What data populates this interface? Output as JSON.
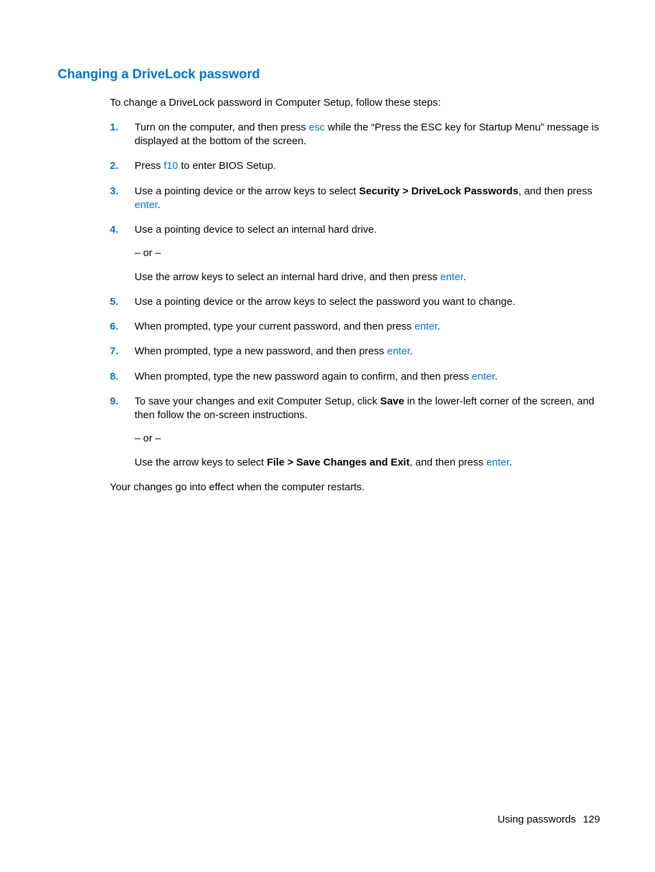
{
  "heading": "Changing a DriveLock password",
  "intro": "To change a DriveLock password in Computer Setup, follow these steps:",
  "steps": [
    {
      "num": "1.",
      "paras": [
        [
          {
            "t": "Turn on the computer, and then press "
          },
          {
            "t": "esc",
            "key": true
          },
          {
            "t": " while the “Press the ESC key for Startup Menu” message is displayed at the bottom of the screen."
          }
        ]
      ]
    },
    {
      "num": "2.",
      "paras": [
        [
          {
            "t": "Press "
          },
          {
            "t": "f10",
            "key": true
          },
          {
            "t": " to enter BIOS Setup."
          }
        ]
      ]
    },
    {
      "num": "3.",
      "paras": [
        [
          {
            "t": "Use a pointing device or the arrow keys to select "
          },
          {
            "t": "Security > DriveLock Passwords",
            "bold": true
          },
          {
            "t": ", and then press "
          },
          {
            "t": "enter",
            "key": true
          },
          {
            "t": "."
          }
        ]
      ]
    },
    {
      "num": "4.",
      "paras": [
        [
          {
            "t": "Use a pointing device to select an internal hard drive."
          }
        ],
        [
          {
            "t": "– or –"
          }
        ],
        [
          {
            "t": "Use the arrow keys to select an internal hard drive, and then press "
          },
          {
            "t": "enter",
            "key": true
          },
          {
            "t": "."
          }
        ]
      ]
    },
    {
      "num": "5.",
      "paras": [
        [
          {
            "t": "Use a pointing device or the arrow keys to select the password you want to change."
          }
        ]
      ]
    },
    {
      "num": "6.",
      "paras": [
        [
          {
            "t": "When prompted, type your current password, and then press "
          },
          {
            "t": "enter",
            "key": true
          },
          {
            "t": "."
          }
        ]
      ]
    },
    {
      "num": "7.",
      "paras": [
        [
          {
            "t": "When prompted, type a new password, and then press "
          },
          {
            "t": "enter",
            "key": true
          },
          {
            "t": "."
          }
        ]
      ]
    },
    {
      "num": "8.",
      "paras": [
        [
          {
            "t": "When prompted, type the new password again to confirm, and then press "
          },
          {
            "t": "enter",
            "key": true
          },
          {
            "t": "."
          }
        ]
      ]
    },
    {
      "num": "9.",
      "paras": [
        [
          {
            "t": "To save your changes and exit Computer Setup, click "
          },
          {
            "t": "Save",
            "bold": true
          },
          {
            "t": " in the lower-left corner of the screen, and then follow the on-screen instructions."
          }
        ],
        [
          {
            "t": "– or –"
          }
        ],
        [
          {
            "t": "Use the arrow keys to select "
          },
          {
            "t": "File > Save Changes and Exit",
            "bold": true
          },
          {
            "t": ", and then press "
          },
          {
            "t": "enter",
            "key": true
          },
          {
            "t": "."
          }
        ]
      ]
    }
  ],
  "outro": "Your changes go into effect when the computer restarts.",
  "footer_section": "Using passwords",
  "footer_page": "129"
}
